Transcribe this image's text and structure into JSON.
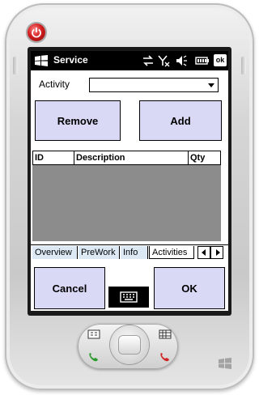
{
  "app": {
    "title": "Service"
  },
  "titlebar": {
    "ok_label": "ok"
  },
  "form": {
    "activity_label": "Activity",
    "activity_value": ""
  },
  "buttons": {
    "remove": "Remove",
    "add": "Add",
    "cancel": "Cancel",
    "ok": "OK"
  },
  "table": {
    "columns": [
      "ID",
      "Description",
      "Qty"
    ],
    "rows": []
  },
  "tabs": {
    "items": [
      "Overview",
      "PreWork",
      "Info",
      "Activities"
    ],
    "active": "Activities"
  },
  "icons": {
    "start": "windows-flag-icon",
    "connectivity": "sync-arrows-icon",
    "signal": "no-signal-icon",
    "sound": "speaker-icon",
    "battery": "battery-icon",
    "keyboard": "keyboard-icon",
    "power": "power-icon"
  },
  "colors": {
    "button_fill": "#d9d9f5",
    "grid_bg": "#8c8c8c",
    "tab_bg": "#dce8f4",
    "titlebar": "#000000"
  }
}
